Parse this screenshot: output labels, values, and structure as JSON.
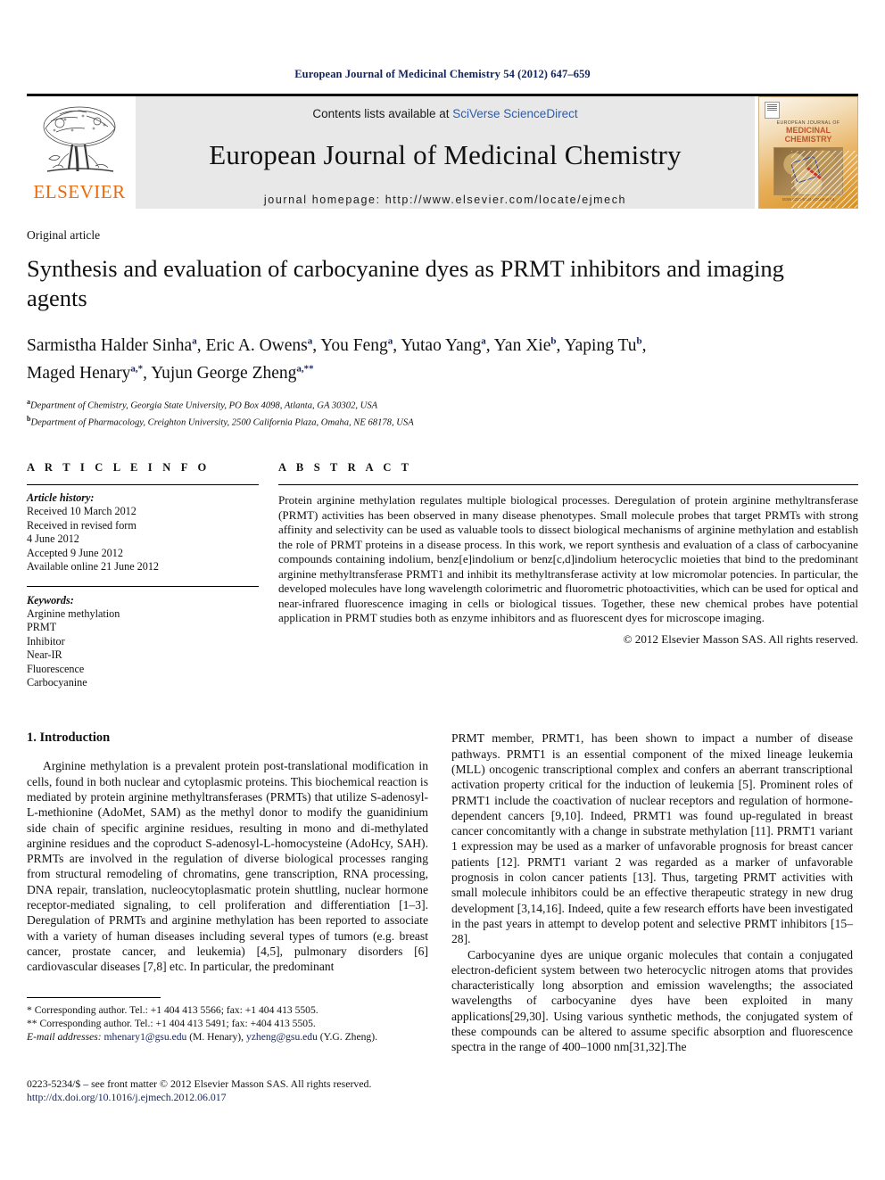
{
  "running_head": "European Journal of Medicinal Chemistry 54 (2012) 647–659",
  "masthead": {
    "publisher_name": "ELSEVIER",
    "contents_prefix": "Contents lists available at ",
    "contents_link": "SciVerse ScienceDirect",
    "journal_title": "European Journal of Medicinal Chemistry",
    "homepage_line": "journal homepage: http://www.elsevier.com/locate/ejmech",
    "cover": {
      "line1": "EUROPEAN JOURNAL OF",
      "line2": "MEDICINAL\nCHEMISTRY",
      "caption": "ISSN 0223-5234 VOLUME 54"
    }
  },
  "article": {
    "type": "Original article",
    "title": "Synthesis and evaluation of carbocyanine dyes as PRMT inhibitors and imaging agents",
    "authors_line1": "Sarmistha Halder Sinha a, Eric A. Owens a, You Feng a, Yutao Yang a, Yan Xie b, Yaping Tu b,",
    "authors_line2": "Maged Henary a,*, Yujun George Zheng a,**",
    "affiliation_a": "Department of Chemistry, Georgia State University, PO Box 4098, Atlanta, GA 30302, USA",
    "affiliation_b": "Department of Pharmacology, Creighton University, 2500 California Plaza, Omaha, NE 68178, USA"
  },
  "info": {
    "heading": "A R T I C L E   I N F O",
    "history_label": "Article history:",
    "history": [
      "Received 10 March 2012",
      "Received in revised form",
      "4 June 2012",
      "Accepted 9 June 2012",
      "Available online 21 June 2012"
    ],
    "keywords_label": "Keywords:",
    "keywords": [
      "Arginine methylation",
      "PRMT",
      "Inhibitor",
      "Near-IR",
      "Fluorescence",
      "Carbocyanine"
    ]
  },
  "abstract": {
    "heading": "A B S T R A C T",
    "text": "Protein arginine methylation regulates multiple biological processes. Deregulation of protein arginine methyltransferase (PRMT) activities has been observed in many disease phenotypes. Small molecule probes that target PRMTs with strong affinity and selectivity can be used as valuable tools to dissect biological mechanisms of arginine methylation and establish the role of PRMT proteins in a disease process. In this work, we report synthesis and evaluation of a class of carbocyanine compounds containing indolium, benz[e]indolium or benz[c,d]indolium heterocyclic moieties that bind to the predominant arginine methyltransferase PRMT1 and inhibit its methyltransferase activity at low micromolar potencies. In particular, the developed molecules have long wavelength colorimetric and fluorometric photoactivities, which can be used for optical and near-infrared fluorescence imaging in cells or biological tissues. Together, these new chemical probes have potential application in PRMT studies both as enzyme inhibitors and as fluorescent dyes for microscope imaging.",
    "copyright": "© 2012 Elsevier Masson SAS. All rights reserved."
  },
  "body": {
    "section_number_title": "1.  Introduction",
    "left_paragraph_1": "Arginine methylation is a prevalent protein post-translational modification in cells, found in both nuclear and cytoplasmic proteins. This biochemical reaction is mediated by protein arginine methyltransferases (PRMTs) that utilize S-adenosyl-L-methionine (AdoMet, SAM) as the methyl donor to modify the guanidinium side chain of specific arginine residues, resulting in mono and di-methylated arginine residues and the coproduct S-adenosyl-L-homocysteine (AdoHcy, SAH). PRMTs are involved in the regulation of diverse biological processes ranging from structural remodeling of chromatins, gene transcription, RNA processing, DNA repair, translation, nucleocytoplasmatic protein shuttling, nuclear hormone receptor-mediated signaling, to cell proliferation and differentiation [1–3]. Deregulation of PRMTs and arginine methylation has been reported to associate with a variety of human diseases including several types of tumors (e.g. breast cancer, prostate cancer, and leukemia) [4,5], pulmonary disorders [6] cardiovascular diseases [7,8] etc. In particular, the predominant",
    "right_paragraph_1": "PRMT member, PRMT1, has been shown to impact a number of disease pathways. PRMT1 is an essential component of the mixed lineage leukemia (MLL) oncogenic transcriptional complex and confers an aberrant transcriptional activation property critical for the induction of leukemia [5]. Prominent roles of PRMT1 include the coactivation of nuclear receptors and regulation of hormone-dependent cancers [9,10]. Indeed, PRMT1 was found up-regulated in breast cancer concomitantly with a change in substrate methylation [11]. PRMT1 variant 1 expression may be used as a marker of unfavorable prognosis for breast cancer patients [12]. PRMT1 variant 2 was regarded as a marker of unfavorable prognosis in colon cancer patients [13]. Thus, targeting PRMT activities with small molecule inhibitors could be an effective therapeutic strategy in new drug development [3,14,16]. Indeed, quite a few research efforts have been investigated in the past years in attempt to develop potent and selective PRMT inhibitors [15–28].",
    "right_paragraph_2": "Carbocyanine dyes are unique organic molecules that contain a conjugated electron-deficient system between two heterocyclic nitrogen atoms that provides characteristically long absorption and emission wavelengths; the associated wavelengths of carbocyanine dyes have been exploited in many applications[29,30]. Using various synthetic methods, the conjugated system of these compounds can be altered to assume specific absorption and fluorescence spectra in the range of 400–1000 nm[31,32].The"
  },
  "footnotes": {
    "corresponding_1": "*  Corresponding author. Tel.: +1 404 413 5566; fax: +1 404 413 5505.",
    "corresponding_2": "**  Corresponding author. Tel.: +1 404 413 5491; fax: +404 413 5505.",
    "email_label": "E-mail addresses:",
    "email_1": "mhenary1@gsu.edu",
    "email_1_owner": "(M. Henary),",
    "email_2": "yzheng@gsu.edu",
    "email_2_owner": "(Y.G. Zheng)."
  },
  "footer": {
    "issn_line": "0223-5234/$ – see front matter © 2012 Elsevier Masson SAS. All rights reserved.",
    "doi": "http://dx.doi.org/10.1016/j.ejmech.2012.06.017"
  },
  "colors": {
    "link_blue": "#13235b",
    "sciencedirect_blue": "#2a5db0",
    "elsevier_orange": "#ea6a10",
    "masthead_gray": "#e8e8e8"
  }
}
